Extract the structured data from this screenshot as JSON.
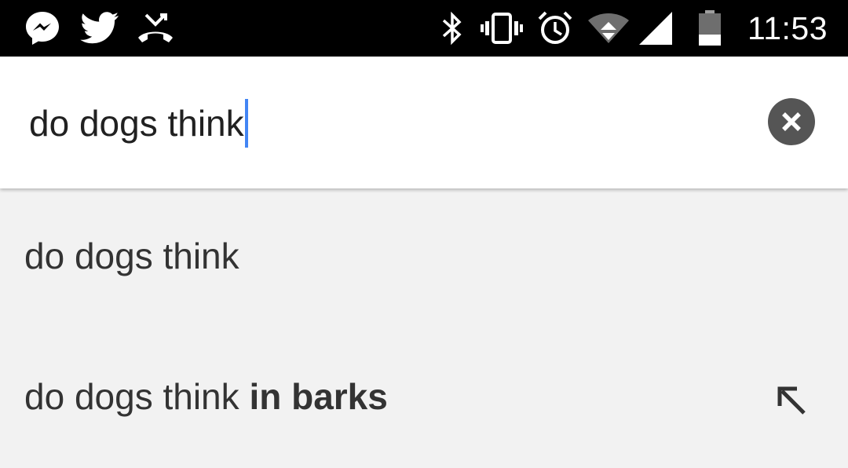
{
  "status_bar": {
    "notification_icons": [
      "messenger-icon",
      "twitter-icon",
      "missed-call-icon"
    ],
    "system_icons": [
      "bluetooth-icon",
      "vibrate-icon",
      "alarm-icon",
      "wifi-icon",
      "signal-icon",
      "battery-icon"
    ],
    "time": "11:53",
    "background_color": "#000000"
  },
  "search": {
    "query": "do dogs think",
    "cursor_color": "#4285f4",
    "clear_icon": "close-icon"
  },
  "suggestions": [
    {
      "prefix": "do dogs think",
      "completion": "",
      "action_icon": ""
    },
    {
      "prefix": "do dogs think",
      "completion": "in barks",
      "action_icon": "arrow-up-left-icon"
    }
  ],
  "colors": {
    "page_background": "#f2f2f2",
    "search_background": "#ffffff",
    "text": "#333333",
    "clear_button": "#555555"
  }
}
